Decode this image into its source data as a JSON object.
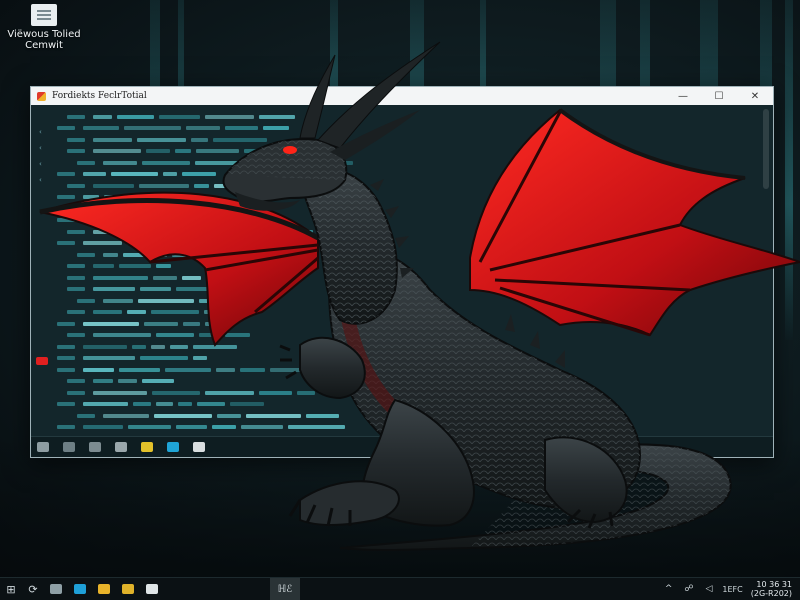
{
  "desktop": {
    "icon": {
      "icon": "file-icon",
      "label_line1": "Viëwous Tolied",
      "label_line2": "Cemwit"
    }
  },
  "window": {
    "title": "Fordiekts FeclrTotial",
    "controls": {
      "minimize": "—",
      "maximize": "☐",
      "close": "✕"
    },
    "app_icon": "app-icon",
    "bottom_toolbar_icons": [
      "monitor-icon",
      "up-icon",
      "folder-icon",
      "display-icon",
      "note-icon",
      "terminal-icon",
      "disk-icon"
    ]
  },
  "taskbar": {
    "start_icon": "windows-icon",
    "search_label": "⟳",
    "pinned": [
      "task-view-icon",
      "browser-icon",
      "explorer-icon",
      "store-icon",
      "calendar-icon"
    ],
    "active_app_label": "ℍℰ",
    "tray": {
      "chevron": "^",
      "network": "☍",
      "volume": "◁",
      "lang": "1EFC",
      "time": "10 36 31",
      "date": "(2G-R202)"
    }
  },
  "colors": {
    "accent_red": "#d8141a",
    "code_teal": "#3fa8b0",
    "taskbar": "#0b1114"
  }
}
